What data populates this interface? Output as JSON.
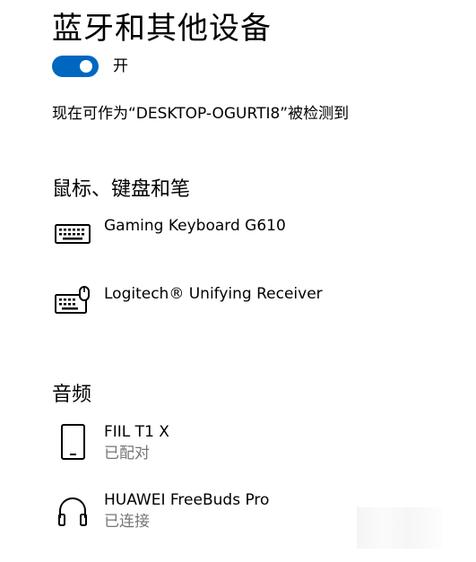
{
  "page": {
    "title": "蓝牙和其他设备"
  },
  "bluetooth": {
    "toggle_state": "on",
    "toggle_label": "开",
    "discoverable_text": "现在可作为“DESKTOP-OGURTI8”被检测到",
    "accent_color": "#0067c0"
  },
  "sections": {
    "input": {
      "heading": "鼠标、键盘和笔",
      "devices": [
        {
          "name": "Gaming Keyboard G610",
          "icon": "keyboard-icon"
        },
        {
          "name": "Logitech® Unifying Receiver",
          "icon": "keyboard-mouse-icon"
        }
      ]
    },
    "audio": {
      "heading": "音频",
      "devices": [
        {
          "name": "FIIL T1 X",
          "status": "已配对",
          "icon": "phone-icon"
        },
        {
          "name": "HUAWEI FreeBuds Pro",
          "status": "已连接",
          "icon": "headphones-icon"
        }
      ]
    }
  }
}
